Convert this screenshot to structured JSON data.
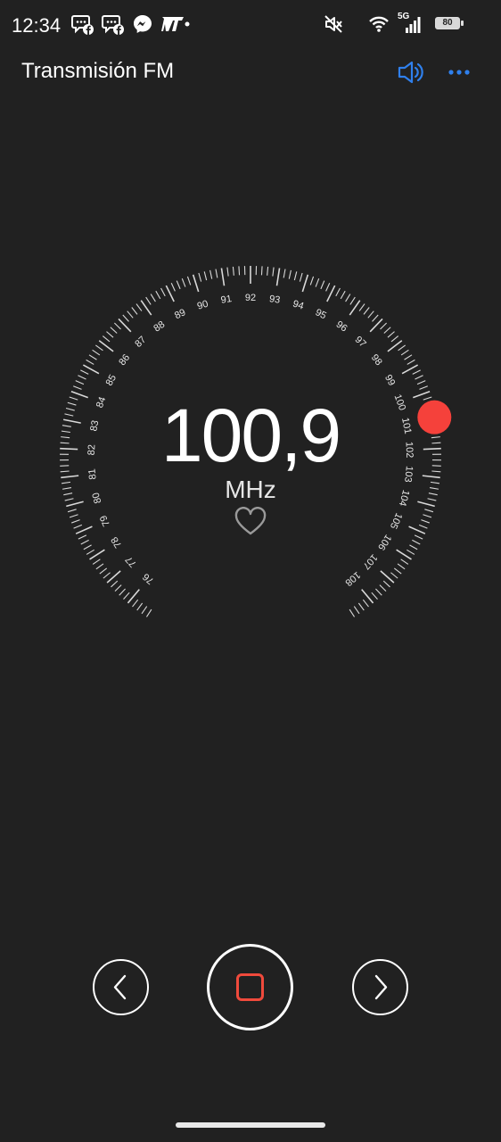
{
  "status_bar": {
    "time": "12:34",
    "network": "5G",
    "battery": "80",
    "left_icons": [
      "facebook-chat-icon",
      "facebook-chat-icon",
      "messenger-icon",
      "m-app-icon"
    ],
    "right_icons": [
      "mute-icon",
      "wifi-icon",
      "signal-icon",
      "battery-icon"
    ]
  },
  "app_bar": {
    "title": "Transmisión FM",
    "volume_icon": "speaker-icon",
    "more_icon": "more-dots-icon",
    "accent_color": "#2f80ed"
  },
  "tuner": {
    "frequency": "100,9",
    "unit": "MHz",
    "dial_labels": [
      "76",
      "77",
      "78",
      "79",
      "80",
      "81",
      "82",
      "83",
      "84",
      "85",
      "86",
      "87",
      "88",
      "89",
      "90",
      "91",
      "92",
      "93",
      "94",
      "95",
      "96",
      "97",
      "98",
      "99",
      "100",
      "101",
      "102",
      "103",
      "104",
      "105",
      "106",
      "107",
      "108"
    ],
    "indicator_color": "#f5413b",
    "favorite_icon": "heart-outline-icon"
  },
  "controls": {
    "prev_icon": "chevron-left-icon",
    "power_icon": "stop-square-icon",
    "next_icon": "chevron-right-icon",
    "power_color": "#f04a3c"
  }
}
